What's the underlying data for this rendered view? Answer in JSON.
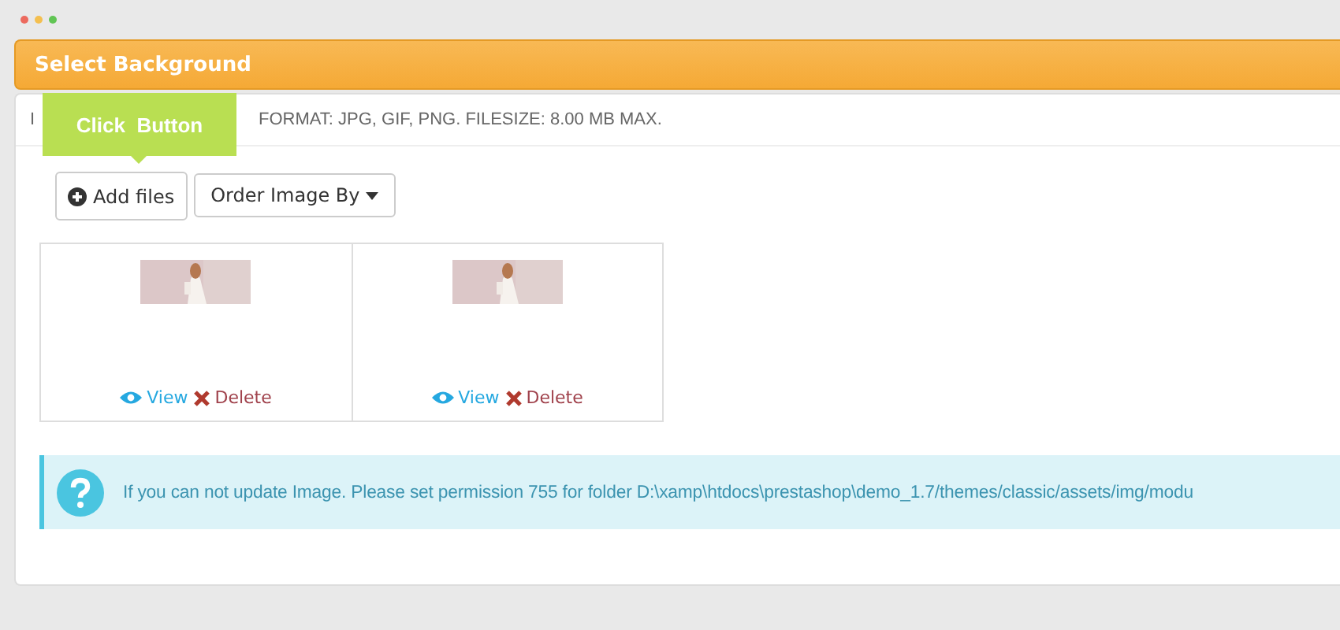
{
  "panel": {
    "title": "Select Background",
    "label": "I",
    "format_note": "FORMAT: JPG, GIF, PNG. FILESIZE: 8.00 MB MAX.",
    "tooltip": "Click  Button",
    "buttons": [
      {
        "kind": "add",
        "label": "Add files"
      },
      {
        "kind": "dropdown",
        "label": "Order Image By"
      }
    ],
    "images": [
      {
        "kind": "picture",
        "view": "View",
        "delete": "Delete"
      },
      {
        "kind": "picture",
        "view": "View",
        "delete": "Delete"
      }
    ],
    "alert": "If you can not update Image. Please set permission 755 for folder D:\\xamp\\htdocs\\prestashop\\demo_1.7/themes/classic/assets/img/modu"
  }
}
